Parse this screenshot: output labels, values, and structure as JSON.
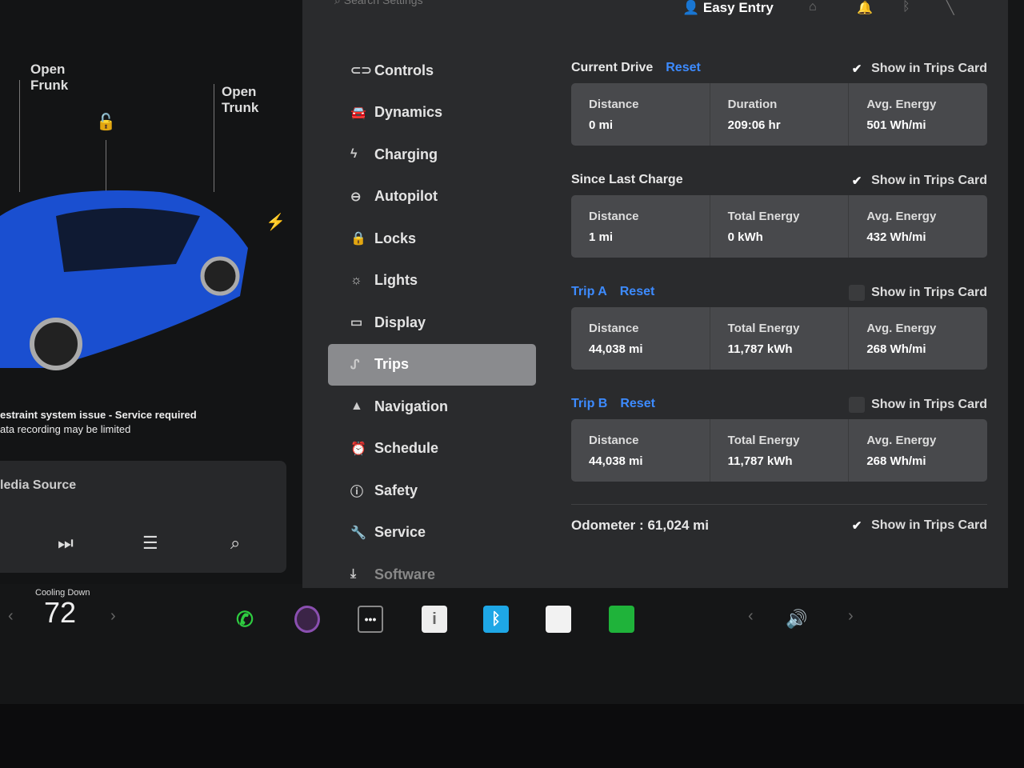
{
  "left": {
    "open_frunk": "Open\nFrunk",
    "open_trunk": "Open\nTrunk",
    "alert_line1": "estraint system issue - Service required",
    "alert_line2": "ata recording may be limited",
    "media_source": "ledia Source"
  },
  "top": {
    "search_placeholder": "Search Settings",
    "profile": "Easy Entry"
  },
  "nav": [
    {
      "label": "Controls",
      "icon": "toggle-icon"
    },
    {
      "label": "Dynamics",
      "icon": "car-icon"
    },
    {
      "label": "Charging",
      "icon": "bolt-icon"
    },
    {
      "label": "Autopilot",
      "icon": "steering-wheel-icon"
    },
    {
      "label": "Locks",
      "icon": "lock-icon"
    },
    {
      "label": "Lights",
      "icon": "sun-icon"
    },
    {
      "label": "Display",
      "icon": "display-icon"
    },
    {
      "label": "Trips",
      "icon": "trips-icon",
      "active": true
    },
    {
      "label": "Navigation",
      "icon": "navigation-icon"
    },
    {
      "label": "Schedule",
      "icon": "clock-icon"
    },
    {
      "label": "Safety",
      "icon": "alert-icon"
    },
    {
      "label": "Service",
      "icon": "wrench-icon"
    },
    {
      "label": "Software",
      "icon": "download-icon"
    }
  ],
  "trips": {
    "show_label": "Show in Trips Card",
    "reset": "Reset",
    "current": {
      "title": "Current Drive",
      "show": true,
      "cells": [
        {
          "k": "Distance",
          "v": "0 mi"
        },
        {
          "k": "Duration",
          "v": "209:06 hr"
        },
        {
          "k": "Avg. Energy",
          "v": "501 Wh/mi"
        }
      ]
    },
    "since": {
      "title": "Since Last Charge",
      "show": true,
      "cells": [
        {
          "k": "Distance",
          "v": "1 mi"
        },
        {
          "k": "Total Energy",
          "v": "0 kWh"
        },
        {
          "k": "Avg. Energy",
          "v": "432 Wh/mi"
        }
      ]
    },
    "tripA": {
      "title": "Trip A",
      "show": false,
      "cells": [
        {
          "k": "Distance",
          "v": "44,038 mi"
        },
        {
          "k": "Total Energy",
          "v": "11,787 kWh"
        },
        {
          "k": "Avg. Energy",
          "v": "268 Wh/mi"
        }
      ]
    },
    "tripB": {
      "title": "Trip B",
      "show": false,
      "cells": [
        {
          "k": "Distance",
          "v": "44,038 mi"
        },
        {
          "k": "Total Energy",
          "v": "11,787 kWh"
        },
        {
          "k": "Avg. Energy",
          "v": "268 Wh/mi"
        }
      ]
    },
    "odometer_label": "Odometer",
    "odometer_sep": ":",
    "odometer_value": "61,024 mi",
    "odometer_show": true
  },
  "dock": {
    "climate_status": "Cooling Down",
    "temperature": "72",
    "colors": {
      "phone": "#2ecc40",
      "bluetooth": "#1ea7e6",
      "stocks": "#1fb33a"
    }
  }
}
